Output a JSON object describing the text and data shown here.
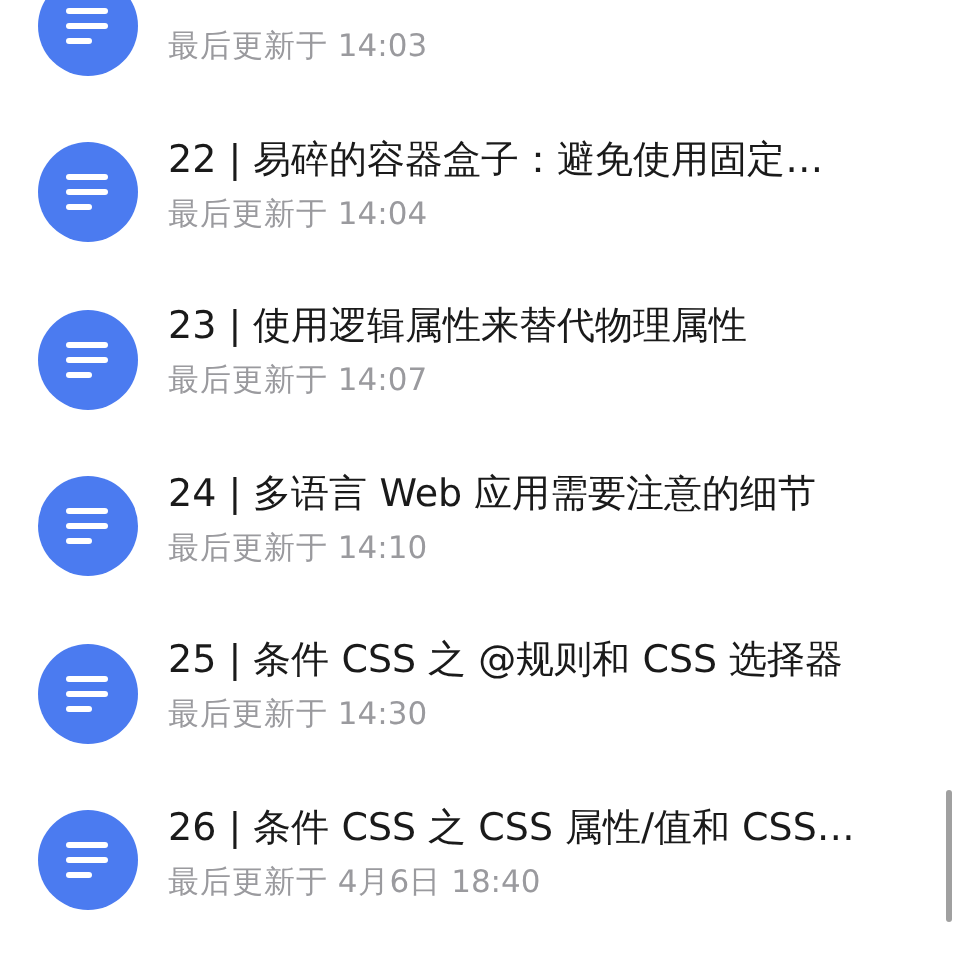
{
  "items": [
    {
      "updated": "最后更新于 14:03"
    },
    {
      "title": "22 | 易碎的容器盒子：避免使用固定…",
      "updated": "最后更新于 14:04"
    },
    {
      "title": "23 | 使用逻辑属性来替代物理属性",
      "updated": "最后更新于 14:07"
    },
    {
      "title": "24 | 多语言 Web 应用需要注意的细节",
      "updated": "最后更新于 14:10"
    },
    {
      "title": "25 | 条件 CSS 之 @规则和 CSS 选择器",
      "updated": "最后更新于 14:30"
    },
    {
      "title": "26 | 条件 CSS 之 CSS 属性/值和 CSS…",
      "updated": "最后更新于 4月6日 18:40"
    }
  ]
}
